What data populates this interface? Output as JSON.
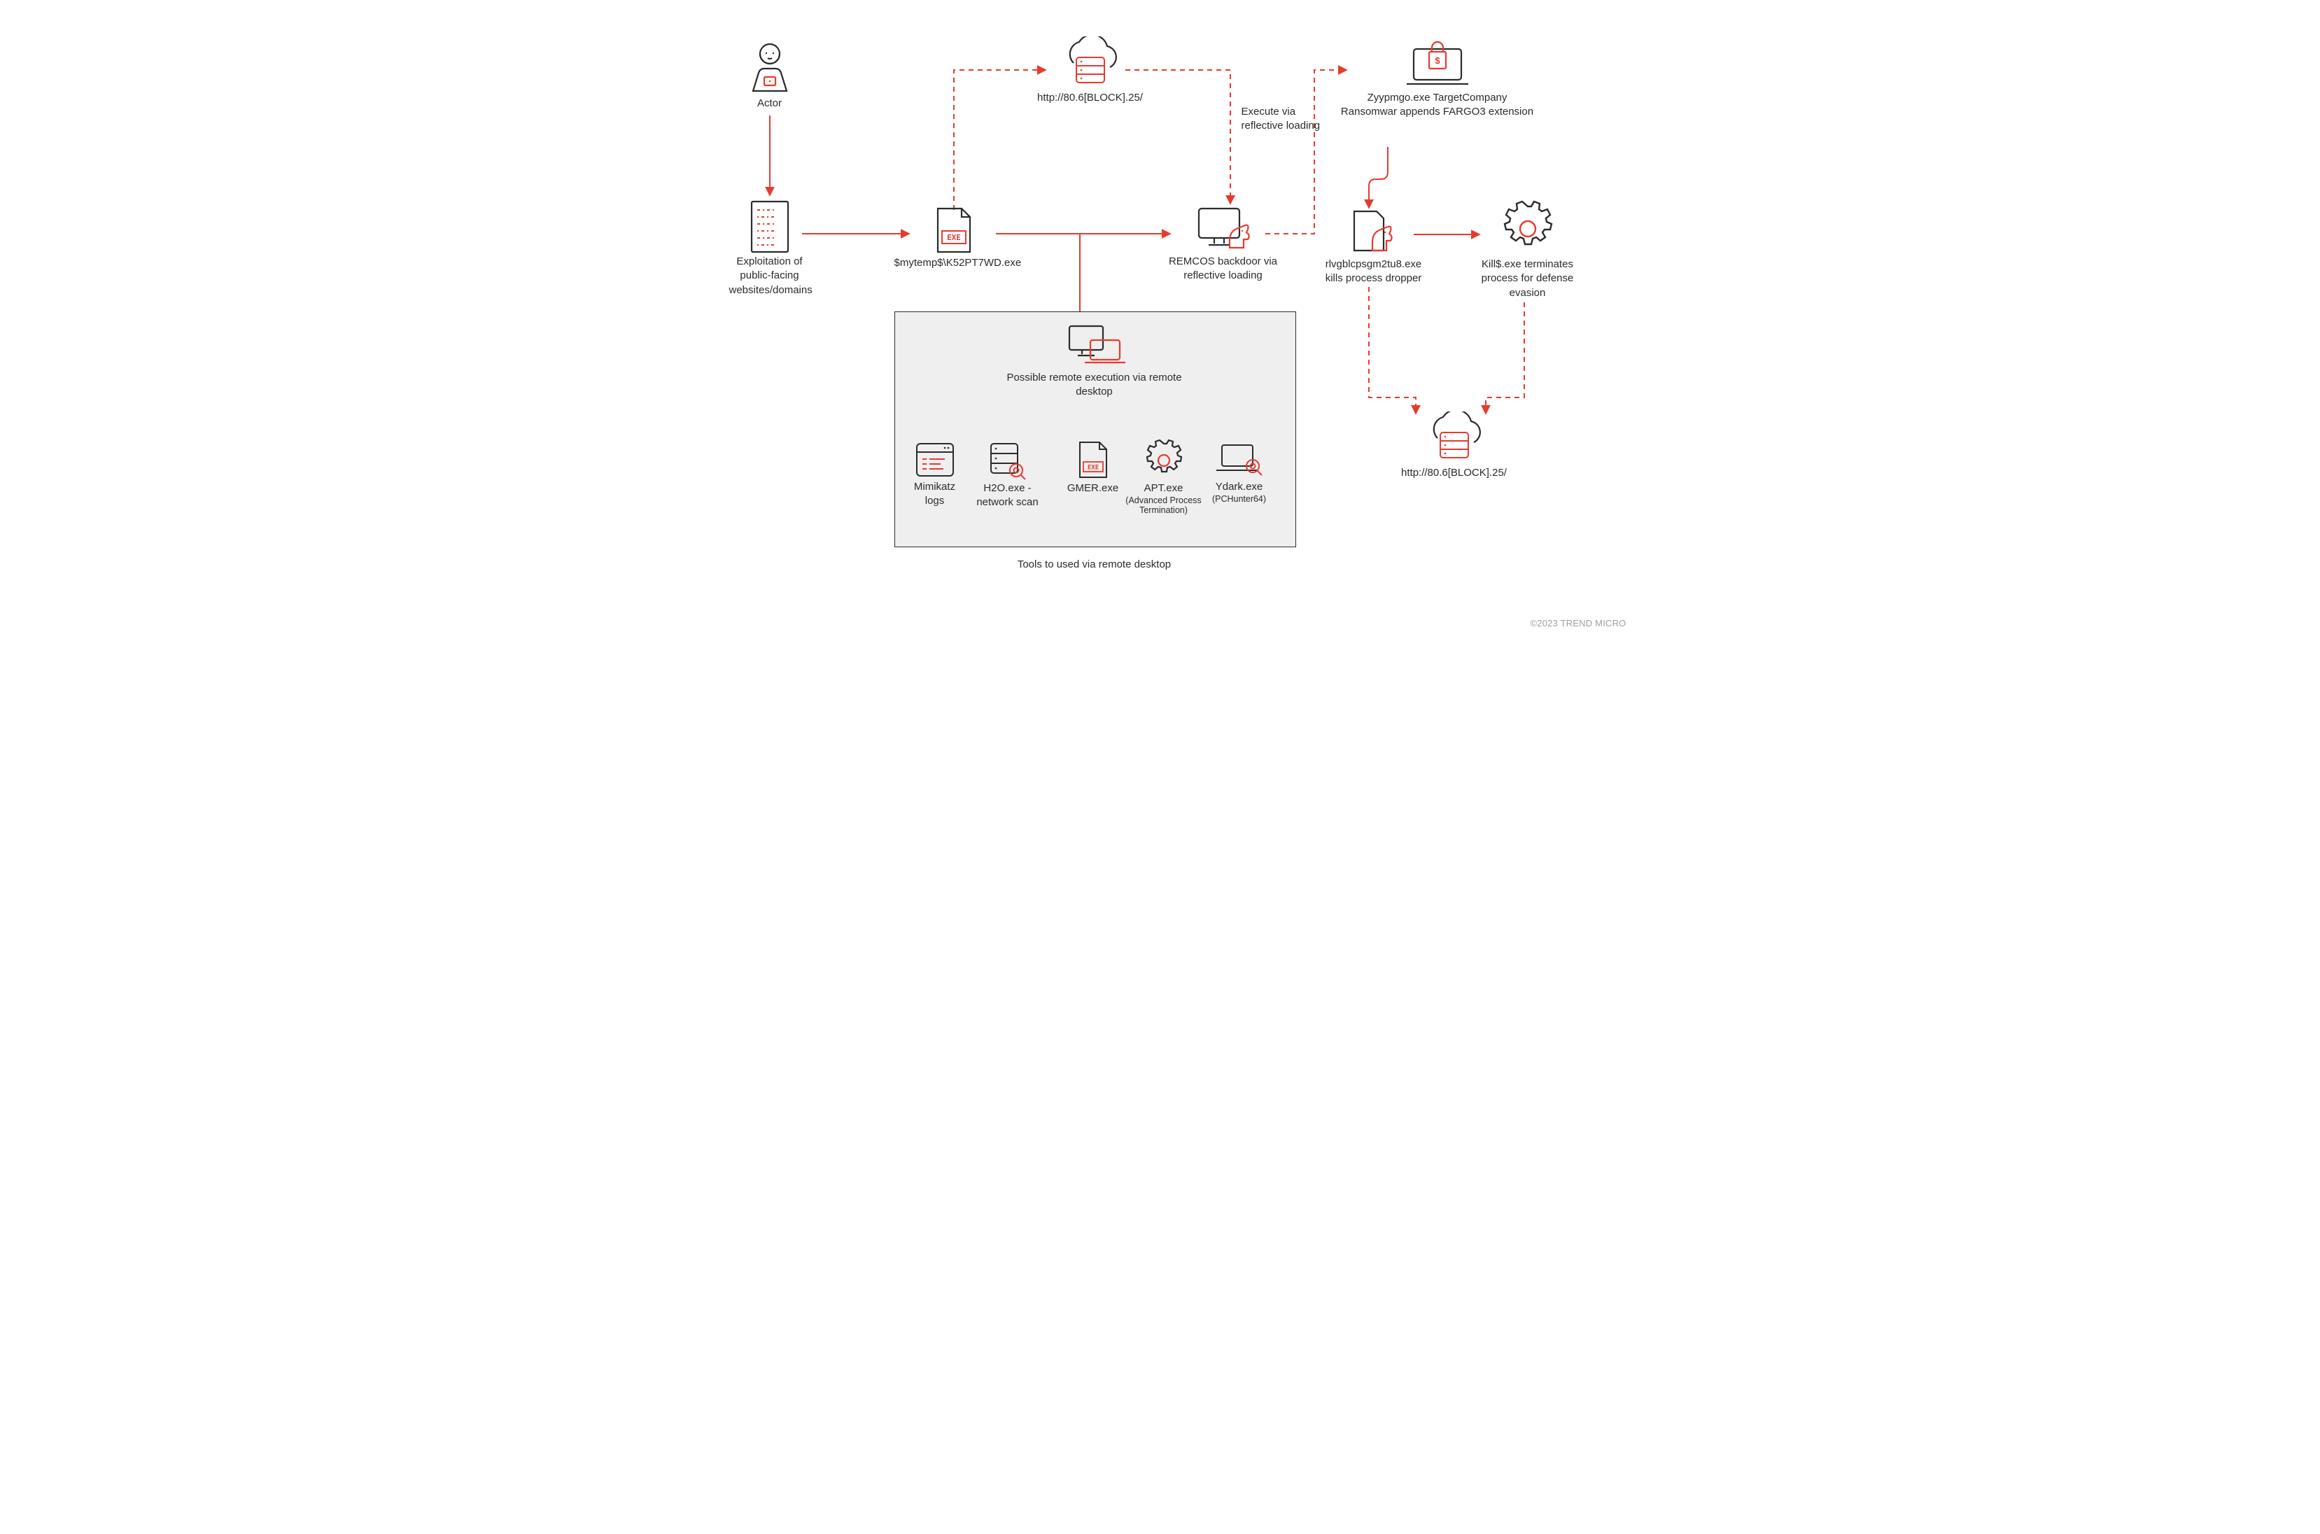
{
  "copyright": "©2023 TREND MICRO",
  "nodes": {
    "actor": "Actor",
    "exploit": "Exploitation of public-facing websites/domains",
    "mytemp": "$mytemp$\\K52PT7WD.exe",
    "cloud1": "http://80.6[BLOCK].25/",
    "execvia": "Execute via reflective loading",
    "remcos": "REMCOS backdoor via reflective loading",
    "ransom": "Zyypmgo.exe TargetCompany Ransomwar appends FARGO3 extension",
    "dropper": "rlvgblcpsgm2tu8.exe kills process dropper",
    "kill": "Kill$.exe terminates process for defense evasion",
    "cloud2": "http://80.6[BLOCK].25/",
    "remotebox_title": "Possible remote execution via remote desktop",
    "tools_caption": "Tools to used via remote desktop",
    "tools": {
      "mimikatz": {
        "title": "Mimikatz logs"
      },
      "h2o": {
        "title": "H2O.exe - network scan"
      },
      "gmer": {
        "title": "GMER.exe"
      },
      "apt": {
        "title": "APT.exe",
        "sub": "(Advanced Process Termination)"
      },
      "ydark": {
        "title": "Ydark.exe",
        "sub": "(PCHunter64)"
      }
    }
  }
}
